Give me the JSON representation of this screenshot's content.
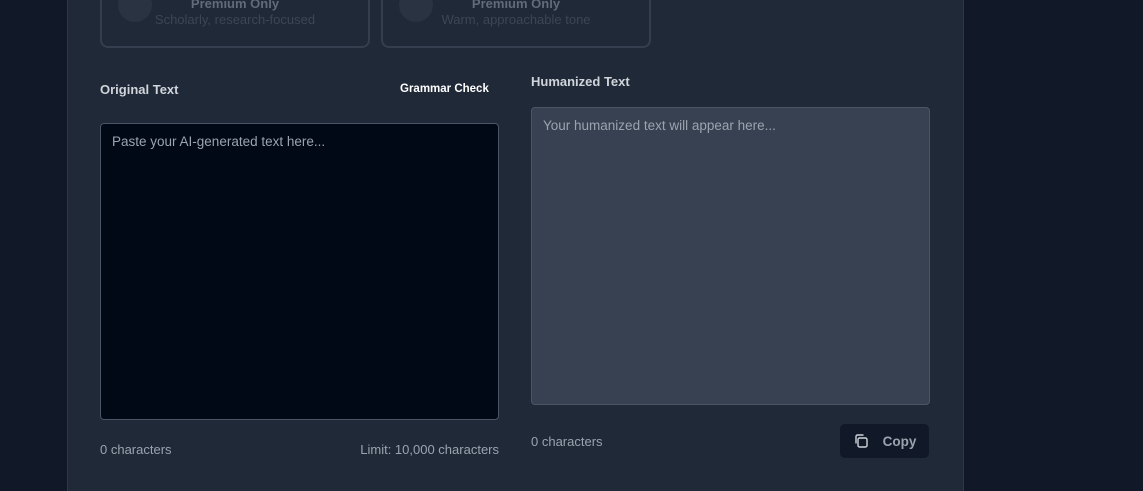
{
  "modes": [
    {
      "id": "academic",
      "premium_label": "Premium Only",
      "description": "Scholarly, research-focused"
    },
    {
      "id": "friendly",
      "premium_label": "Premium Only",
      "description": "Warm, approachable tone"
    }
  ],
  "original": {
    "label": "Original Text",
    "grammar_check_label": "Grammar Check",
    "placeholder": "Paste your AI-generated text here...",
    "char_count": "0 characters",
    "limit": "Limit: 10,000 characters"
  },
  "humanized": {
    "label": "Humanized Text",
    "placeholder": "Your humanized text will appear here...",
    "char_count": "0 characters",
    "copy_label": "Copy",
    "copy_icon": "copy-icon"
  },
  "colors": {
    "page_bg": "#111827",
    "panel_bg": "#1f2937",
    "original_textarea_bg": "#010816",
    "humanized_textarea_bg": "#374151"
  }
}
